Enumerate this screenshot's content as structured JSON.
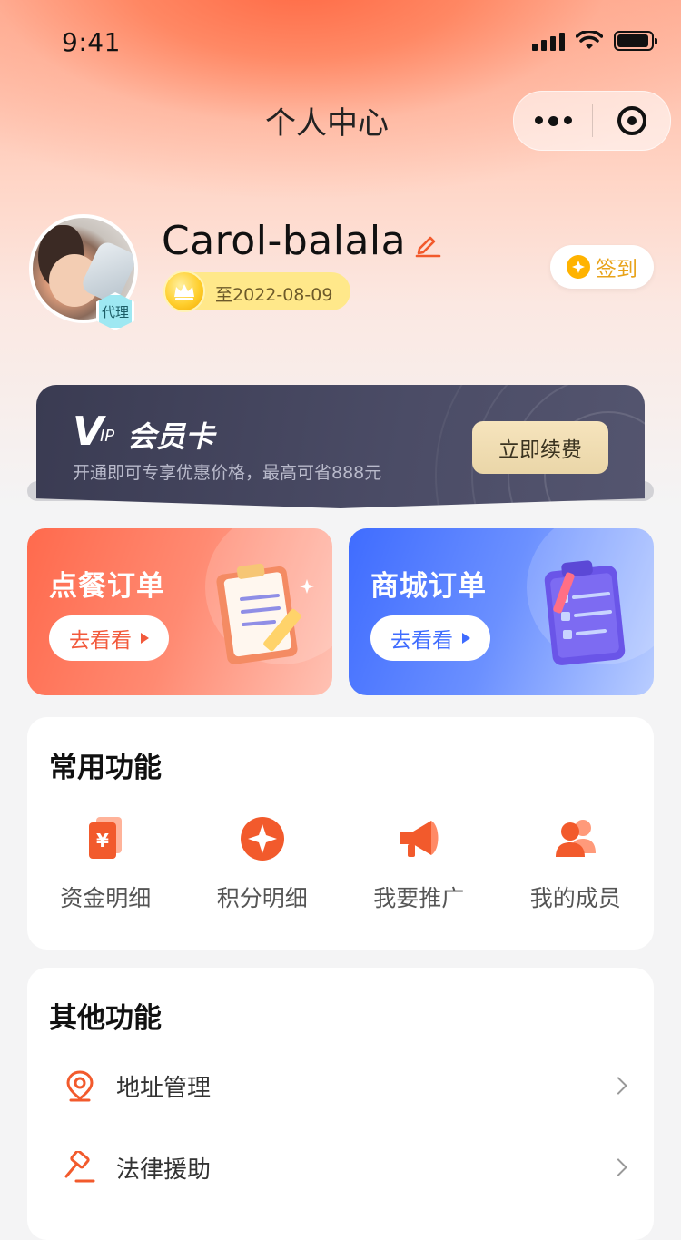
{
  "status_bar": {
    "time": "9:41"
  },
  "nav": {
    "title": "个人中心"
  },
  "profile": {
    "name": "Carol-balala",
    "role_badge": "代理",
    "vip_expire": "至2022-08-09",
    "signin_label": "签到"
  },
  "vip_card": {
    "logo_v": "V",
    "logo_ip": "IP",
    "logo_text": "会员卡",
    "subtitle": "开通即可专享优惠价格，最高可省888元",
    "renew_label": "立即续费"
  },
  "orders": [
    {
      "title": "点餐订单",
      "button": "去看看"
    },
    {
      "title": "商城订单",
      "button": "去看看"
    }
  ],
  "common": {
    "title": "常用功能",
    "items": [
      {
        "label": "资金明细",
        "icon": "yuan-card-icon"
      },
      {
        "label": "积分明细",
        "icon": "points-star-icon"
      },
      {
        "label": "我要推广",
        "icon": "megaphone-icon"
      },
      {
        "label": "我的成员",
        "icon": "members-icon"
      }
    ]
  },
  "other": {
    "title": "其他功能",
    "items": [
      {
        "label": "地址管理",
        "icon": "location-pin-icon"
      },
      {
        "label": "法律援助",
        "icon": "gavel-icon"
      }
    ]
  },
  "colors": {
    "accent_orange": "#f25a2c",
    "vip_gold": "#ffe88a",
    "vip_dark": "#3a3b52",
    "mall_blue": "#3f6cff"
  }
}
